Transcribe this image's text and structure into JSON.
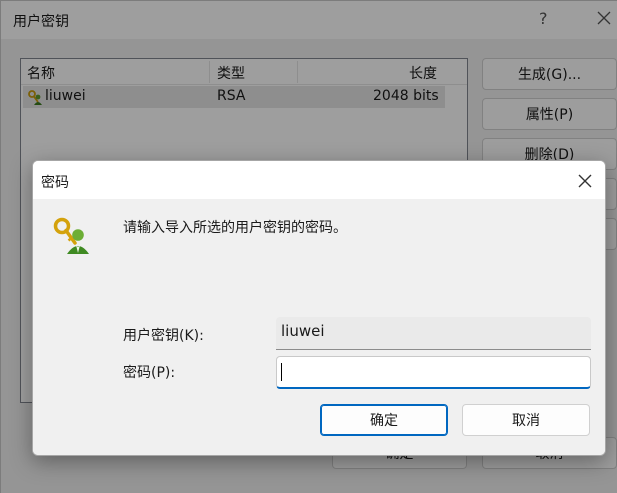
{
  "background_window": {
    "title": "用户密钥",
    "help_glyph": "?",
    "close_icon": "close-icon",
    "columns": [
      "名称",
      "类型",
      "长度"
    ],
    "rows": [
      {
        "name": "liuwei",
        "type": "RSA",
        "length": "2048 bits",
        "icon": "user-key-icon"
      }
    ],
    "buttons": [
      "生成(G)...",
      "属性(P)",
      "删除(D)"
    ],
    "bottom_buttons": [
      "确定",
      "取消"
    ]
  },
  "dialog": {
    "title": "密码",
    "close_icon": "close-icon",
    "icon": "user-key-icon",
    "message": "请输入导入所选的用户密钥的密码。",
    "user_key_label": "用户密钥(K):",
    "user_key_value": "liuwei",
    "password_label": "密码(P):",
    "password_value": "",
    "ok_label": "确定",
    "cancel_label": "取消"
  },
  "colors": {
    "accent": "#0067c0",
    "selected_row": "#e5e5e5",
    "dialog_body": "#f0f0f0"
  }
}
